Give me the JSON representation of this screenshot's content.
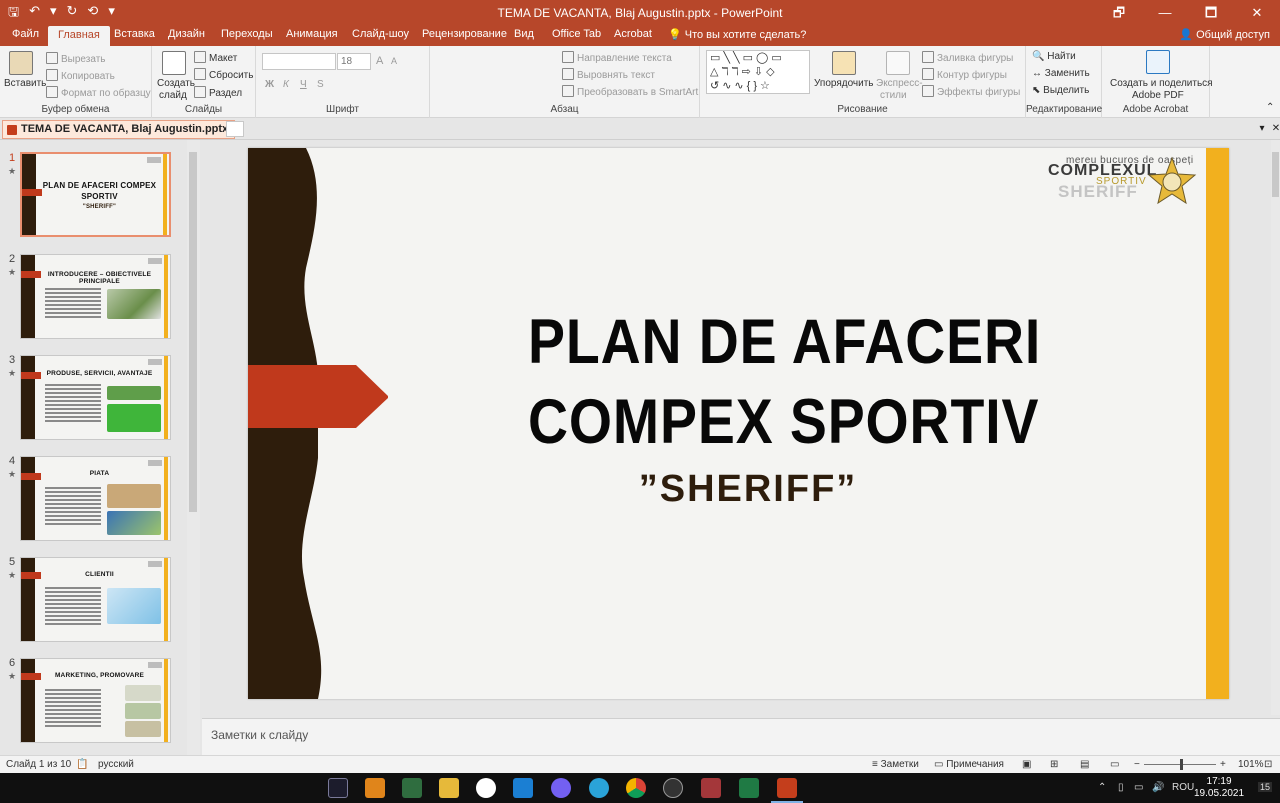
{
  "window": {
    "title": "TEMA DE VACANTA, Blaj Augustin.pptx - PowerPoint",
    "qat": [
      "🖫",
      "↶",
      "▾",
      "↻",
      "⟲",
      "▾"
    ],
    "controls": [
      "🗗",
      "—",
      "🗖",
      "✕"
    ]
  },
  "tabs": [
    "Файл",
    "Главная",
    "Вставка",
    "Дизайн",
    "Переходы",
    "Анимация",
    "Слайд-шоу",
    "Рецензирование",
    "Вид",
    "Office Tab",
    "Acrobat"
  ],
  "active_tab": "Главная",
  "tell_me": "Что вы хотите сделать?",
  "share": "Общий доступ",
  "ribbon": {
    "clipboard": {
      "paste": "Вставить",
      "cut": "Вырезать",
      "copy": "Копировать",
      "format_painter": "Формат по образцу",
      "label": "Буфер обмена"
    },
    "slides": {
      "new_slide_1": "Создать",
      "new_slide_2": "слайд",
      "layout": "Макет",
      "reset": "Сбросить",
      "section": "Раздел",
      "label": "Слайды"
    },
    "font": {
      "size": "18",
      "bold": "Ж",
      "italic": "К",
      "underline": "Ч",
      "strike": "S",
      "grow": "A",
      "shrink": "A",
      "label": "Шрифт"
    },
    "paragraph": {
      "text_direction": "Направление текста",
      "align_text": "Выровнять текст",
      "smartart": "Преобразовать в SmartArt",
      "label": "Абзац"
    },
    "drawing": {
      "shapes": "▭╲╲▭◯▭ △ℸℸ⇨⇩◇ ↺∿∿{}☆",
      "arrange_1": "Упорядочить",
      "express_1": "Экспресс-",
      "express_2": "стили",
      "fill": "Заливка фигуры",
      "outline": "Контур фигуры",
      "effects": "Эффекты фигуры",
      "label": "Рисование"
    },
    "editing": {
      "find": "Найти",
      "replace": "Заменить",
      "select": "Выделить",
      "label": "Редактирование"
    },
    "acrobat": {
      "create_1": "Создать и поделиться",
      "create_2": "Adobe PDF",
      "label": "Adobe Acrobat"
    }
  },
  "doc_tab": "TEMA DE VACANTA, Blaj Augustin.pptx",
  "thumbnails": [
    {
      "num": "1",
      "title": "PLAN DE AFACERI COMPEX SPORTIV",
      "sub": "\"SHERIFF\""
    },
    {
      "num": "2",
      "title": "INTRODUCERE – OBIECTIVELE PRINCIPALE"
    },
    {
      "num": "3",
      "title": "PRODUSE, SERVICII, AVANTAJE"
    },
    {
      "num": "4",
      "title": "PIATA"
    },
    {
      "num": "5",
      "title": "CLIENTII"
    },
    {
      "num": "6",
      "title": "MARKETING, PROMOVARE"
    }
  ],
  "slide": {
    "title_line1": "PLAN DE AFACERI",
    "title_line2": "COMPEX SPORTIV",
    "subtitle": "”SHERIFF”",
    "logo_tagline": "mereu bucuros de oaspeți",
    "logo_main": "COMPLEXUL",
    "logo_sport": "SPORTIV",
    "logo_sheriff": "SHERIFF"
  },
  "notes_placeholder": "Заметки к слайду",
  "status": {
    "slide_count": "Слайд 1 из 10",
    "language": "русский",
    "notes": "Заметки",
    "comments": "Примечания",
    "zoom": "101%"
  },
  "taskbar": {
    "lang": "ROU",
    "time": "17:19",
    "date": "19.05.2021",
    "notif_count": "15"
  },
  "colors": {
    "accent": "#b7472a",
    "slide_brown": "#2e1d0c",
    "slide_red": "#c0391c",
    "slide_yellow": "#f2b01e"
  }
}
